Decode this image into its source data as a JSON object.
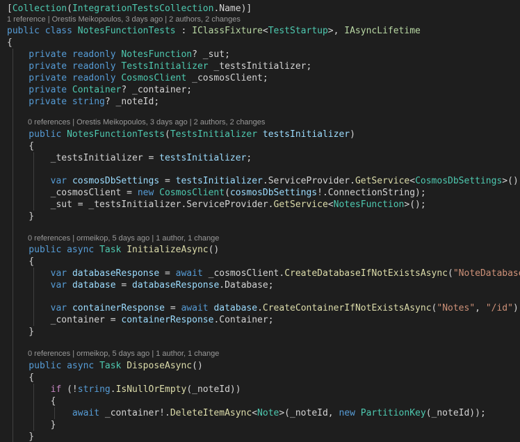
{
  "colors": {
    "background": "#1e1e1e",
    "text": "#d4d4d4",
    "keyword": "#569cd6",
    "control_keyword": "#c586c0",
    "type": "#4ec9b0",
    "interface": "#b8d7a3",
    "method": "#dcdcaa",
    "string": "#ce9178",
    "parameter": "#9cdcfe",
    "codelens": "#999999",
    "indent_guide": "#404040"
  },
  "codelens": [
    "1 reference | Orestis Meikopoulos, 3 days ago | 2 authors, 2 changes",
    "0 references | Orestis Meikopoulos, 3 days ago | 2 authors, 2 changes",
    "0 references | ormeikop, 5 days ago | 1 author, 1 change",
    "0 references | ormeikop, 5 days ago | 1 author, 1 change"
  ],
  "code_lines": [
    [
      [
        "[",
        "txt"
      ],
      [
        "Collection",
        "type"
      ],
      [
        "(",
        "txt"
      ],
      [
        "IntegrationTestsCollection",
        "type"
      ],
      [
        ".Name)]",
        "txt"
      ]
    ],
    [
      [
        "public class ",
        "kw"
      ],
      [
        "NotesFunctionTests",
        "type"
      ],
      [
        " : ",
        "txt"
      ],
      [
        "IClassFixture",
        "iface"
      ],
      [
        "<",
        "txt"
      ],
      [
        "TestStartup",
        "type"
      ],
      [
        ">, ",
        "txt"
      ],
      [
        "IAsyncLifetime",
        "iface"
      ]
    ],
    [
      [
        "{",
        "txt"
      ]
    ],
    [
      [
        "    private readonly ",
        "kw"
      ],
      [
        "NotesFunction",
        "type"
      ],
      [
        "? _sut;",
        "txt"
      ]
    ],
    [
      [
        "    private readonly ",
        "kw"
      ],
      [
        "TestsInitializer",
        "type"
      ],
      [
        " _testsInitializer;",
        "txt"
      ]
    ],
    [
      [
        "    private readonly ",
        "kw"
      ],
      [
        "CosmosClient",
        "type"
      ],
      [
        " _cosmosClient;",
        "txt"
      ]
    ],
    [
      [
        "    private ",
        "kw"
      ],
      [
        "Container",
        "type"
      ],
      [
        "? _container;",
        "txt"
      ]
    ],
    [
      [
        "    private string",
        "kw"
      ],
      [
        "? _noteId;",
        "txt"
      ]
    ],
    [
      [
        "    public ",
        "kw"
      ],
      [
        "NotesFunctionTests",
        "type"
      ],
      [
        "(",
        "txt"
      ],
      [
        "TestsInitializer",
        "type"
      ],
      [
        " ",
        "txt"
      ],
      [
        "testsInitializer",
        "prm"
      ],
      [
        ")",
        "txt"
      ]
    ],
    [
      [
        "    {",
        "txt"
      ]
    ],
    [
      [
        "        _testsInitializer = ",
        "txt"
      ],
      [
        "testsInitializer",
        "prm"
      ],
      [
        ";",
        "txt"
      ]
    ],
    [
      [
        "        ",
        "txt"
      ],
      [
        "var ",
        "kw"
      ],
      [
        "cosmosDbSettings",
        "prm"
      ],
      [
        " = ",
        "txt"
      ],
      [
        "testsInitializer",
        "prm"
      ],
      [
        ".ServiceProvider.",
        "txt"
      ],
      [
        "GetService",
        "fn"
      ],
      [
        "<",
        "txt"
      ],
      [
        "CosmosDbSettings",
        "type"
      ],
      [
        ">();",
        "txt"
      ]
    ],
    [
      [
        "        _cosmosClient = ",
        "txt"
      ],
      [
        "new ",
        "kw"
      ],
      [
        "CosmosClient",
        "type"
      ],
      [
        "(",
        "txt"
      ],
      [
        "cosmosDbSettings",
        "prm"
      ],
      [
        "!.ConnectionString);",
        "txt"
      ]
    ],
    [
      [
        "        _sut = _testsInitializer.ServiceProvider.",
        "txt"
      ],
      [
        "GetService",
        "fn"
      ],
      [
        "<",
        "txt"
      ],
      [
        "NotesFunction",
        "type"
      ],
      [
        ">();",
        "txt"
      ]
    ],
    [
      [
        "    }",
        "txt"
      ]
    ],
    [
      [
        "    public async ",
        "kw"
      ],
      [
        "Task",
        "type"
      ],
      [
        " ",
        "txt"
      ],
      [
        "InitializeAsync",
        "fn"
      ],
      [
        "()",
        "txt"
      ]
    ],
    [
      [
        "    {",
        "txt"
      ]
    ],
    [
      [
        "        ",
        "txt"
      ],
      [
        "var ",
        "kw"
      ],
      [
        "databaseResponse",
        "prm"
      ],
      [
        " = ",
        "txt"
      ],
      [
        "await",
        "kw"
      ],
      [
        " _cosmosClient.",
        "txt"
      ],
      [
        "CreateDatabaseIfNotExistsAsync",
        "fn"
      ],
      [
        "(",
        "txt"
      ],
      [
        "\"NoteDatabase\"",
        "str"
      ],
      [
        ");",
        "txt"
      ]
    ],
    [
      [
        "        ",
        "txt"
      ],
      [
        "var ",
        "kw"
      ],
      [
        "database",
        "prm"
      ],
      [
        " = ",
        "txt"
      ],
      [
        "databaseResponse",
        "prm"
      ],
      [
        ".Database;",
        "txt"
      ]
    ],
    [
      [
        "        ",
        "txt"
      ],
      [
        "var ",
        "kw"
      ],
      [
        "containerResponse",
        "prm"
      ],
      [
        " = ",
        "txt"
      ],
      [
        "await ",
        "kw"
      ],
      [
        "database",
        "prm"
      ],
      [
        ".",
        "txt"
      ],
      [
        "CreateContainerIfNotExistsAsync",
        "fn"
      ],
      [
        "(",
        "txt"
      ],
      [
        "\"Notes\"",
        "str"
      ],
      [
        ", ",
        "txt"
      ],
      [
        "\"/id\"",
        "str"
      ],
      [
        ");",
        "txt"
      ]
    ],
    [
      [
        "        _container = ",
        "txt"
      ],
      [
        "containerResponse",
        "prm"
      ],
      [
        ".Container;",
        "txt"
      ]
    ],
    [
      [
        "    }",
        "txt"
      ]
    ],
    [
      [
        "    public async ",
        "kw"
      ],
      [
        "Task",
        "type"
      ],
      [
        " ",
        "txt"
      ],
      [
        "DisposeAsync",
        "fn"
      ],
      [
        "()",
        "txt"
      ]
    ],
    [
      [
        "    {",
        "txt"
      ]
    ],
    [
      [
        "        ",
        "txt"
      ],
      [
        "if",
        "ctl"
      ],
      [
        " (!",
        "txt"
      ],
      [
        "string",
        "kw"
      ],
      [
        ".",
        "txt"
      ],
      [
        "IsNullOrEmpty",
        "fn"
      ],
      [
        "(_noteId))",
        "txt"
      ]
    ],
    [
      [
        "        {",
        "txt"
      ]
    ],
    [
      [
        "            ",
        "txt"
      ],
      [
        "await",
        "kw"
      ],
      [
        " _container!.",
        "txt"
      ],
      [
        "DeleteItemAsync",
        "fn"
      ],
      [
        "<",
        "txt"
      ],
      [
        "Note",
        "type"
      ],
      [
        ">(_noteId, ",
        "txt"
      ],
      [
        "new ",
        "kw"
      ],
      [
        "PartitionKey",
        "type"
      ],
      [
        "(_noteId));",
        "txt"
      ]
    ],
    [
      [
        "        }",
        "txt"
      ]
    ],
    [
      [
        "    }",
        "txt"
      ]
    ]
  ]
}
